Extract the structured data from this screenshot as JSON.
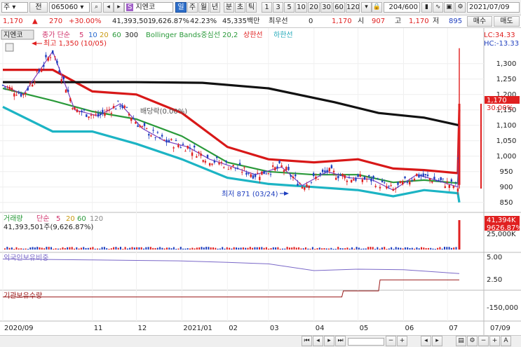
{
  "toolbar": {
    "market": "주",
    "type_label": "전",
    "code": "065060",
    "name": "지엔코",
    "name_tag": "일",
    "periods": [
      "주",
      "월",
      "년",
      "분",
      "초",
      "틱"
    ],
    "intervals": [
      "1",
      "3",
      "5",
      "10",
      "20",
      "30",
      "60",
      "120"
    ],
    "count": "204/600",
    "date": "2021/07/09"
  },
  "quote": {
    "price": "1,170",
    "change": "270",
    "change_pct": "+30.00%",
    "volume": "41,393,501",
    "vol_ratio": "9,626.87%",
    "turnover": "42.23%",
    "amount": "45,335백만",
    "prev_label": "최우선",
    "prev_value": "0",
    "open_price": "1,170",
    "open_label": "시",
    "open_value": "907",
    "high_label": "고",
    "high_value": "1,170",
    "low_label": "저",
    "low_value": "895",
    "sell_btn": "매수",
    "buy_btn": "매도"
  },
  "legend": {
    "name": "지엔코",
    "ma": "종가 단순",
    "p5": "5",
    "p10": "10",
    "p20": "20",
    "p60": "60",
    "p300": "300",
    "bb": "Bollinger Bands중심선 20,2",
    "upper": "상한선",
    "lower": "하한선",
    "lc": "LC:34.33",
    "hc": "HC:-13.33",
    "high_note": "최고 1,350 (10/05)",
    "low_note": "최저 871 (03/24)",
    "div_note": "배당락(0.00%)",
    "price_tag": "1,170",
    "pct_tag": "30.00%"
  },
  "volume_panel": {
    "legend": "거래량",
    "ma": "단순",
    "p5": "5",
    "p20": "20",
    "p60": "60",
    "p120": "120",
    "value": "41,393,501주(9,626.87%)",
    "tag1": "41,394K",
    "tag2": "9626.87%",
    "tick": "25,000K"
  },
  "foreign_panel": {
    "legend": "외국인보유비중",
    "ticks": [
      "5.00",
      "2.50"
    ]
  },
  "inst_panel": {
    "legend": "기관보유수량",
    "ticks": [
      "-150,000"
    ]
  },
  "chart_data": {
    "type": "candlestick",
    "title": "지엔코",
    "ylim": [
      820,
      1370
    ],
    "yticks": [
      1300,
      1250,
      1200,
      1150,
      1100,
      1050,
      1000,
      950,
      900,
      850
    ],
    "xticks": [
      "2020/09",
      "11",
      "12",
      "2021/01",
      "02",
      "03",
      "04",
      "05",
      "06",
      "07",
      "07/09"
    ],
    "close_path": [
      [
        "2020/09/01",
        1230
      ],
      [
        "2020/09/15",
        1200
      ],
      [
        "2020/10/05",
        1340
      ],
      [
        "2020/10/20",
        1150
      ],
      [
        "2020/11/05",
        1130
      ],
      [
        "2020/11/20",
        1170
      ],
      [
        "2020/12/05",
        1090
      ],
      [
        "2020/12/20",
        1050
      ],
      [
        "2021/01/05",
        1030
      ],
      [
        "2021/01/20",
        990
      ],
      [
        "2021/02/05",
        965
      ],
      [
        "2021/02/20",
        940
      ],
      [
        "2021/03/10",
        965
      ],
      [
        "2021/03/24",
        905
      ],
      [
        "2021/04/10",
        950
      ],
      [
        "2021/04/25",
        930
      ],
      [
        "2021/05/10",
        925
      ],
      [
        "2021/05/25",
        890
      ],
      [
        "2021/06/10",
        940
      ],
      [
        "2021/06/25",
        920
      ],
      [
        "2021/07/08",
        900
      ],
      [
        "2021/07/09",
        1170
      ]
    ],
    "ma300": [
      [
        "2020/09/01",
        1240
      ],
      [
        "2020/10/15",
        1240
      ],
      [
        "2020/12/01",
        1240
      ],
      [
        "2021/01/15",
        1238
      ],
      [
        "2021/03/01",
        1220
      ],
      [
        "2021/04/15",
        1175
      ],
      [
        "2021/05/15",
        1140
      ],
      [
        "2021/06/15",
        1125
      ],
      [
        "2021/07/09",
        1100
      ]
    ],
    "bb_upper": [
      [
        "2020/09/01",
        1280
      ],
      [
        "2020/10/05",
        1280
      ],
      [
        "2020/11/01",
        1210
      ],
      [
        "2020/12/01",
        1200
      ],
      [
        "2021/01/01",
        1140
      ],
      [
        "2021/02/01",
        1030
      ],
      [
        "2021/03/01",
        990
      ],
      [
        "2021/04/01",
        980
      ],
      [
        "2021/05/01",
        990
      ],
      [
        "2021/05/25",
        960
      ],
      [
        "2021/06/15",
        955
      ],
      [
        "2021/07/08",
        945
      ],
      [
        "2021/07/09",
        1150
      ]
    ],
    "bb_lower": [
      [
        "2020/09/01",
        1160
      ],
      [
        "2020/10/05",
        1080
      ],
      [
        "2020/11/01",
        1080
      ],
      [
        "2020/12/01",
        1040
      ],
      [
        "2021/01/01",
        990
      ],
      [
        "2021/02/01",
        930
      ],
      [
        "2021/03/01",
        910
      ],
      [
        "2021/04/01",
        900
      ],
      [
        "2021/05/01",
        890
      ],
      [
        "2021/05/25",
        870
      ],
      [
        "2021/06/15",
        890
      ],
      [
        "2021/07/08",
        880
      ],
      [
        "2021/07/09",
        850
      ]
    ],
    "high": {
      "value": 1350,
      "date": "2020/10/05"
    },
    "low": {
      "value": 871,
      "date": "2021/03/24"
    },
    "last": 1170,
    "foreign_ratio": [
      [
        "2020/09/01",
        5.0
      ],
      [
        "2020/10/01",
        4.9
      ],
      [
        "2020/11/01",
        4.8
      ],
      [
        "2020/12/01",
        4.7
      ],
      [
        "2021/01/01",
        4.6
      ],
      [
        "2021/02/01",
        4.3
      ],
      [
        "2021/03/01",
        4.0
      ],
      [
        "2021/04/01",
        2.6
      ],
      [
        "2021/05/01",
        2.9
      ],
      [
        "2021/06/01",
        2.8
      ],
      [
        "2021/07/09",
        2.0
      ]
    ],
    "inst_holdings": [
      [
        "2020/09/01",
        -20000
      ],
      [
        "2021/04/20",
        -20000
      ],
      [
        "2021/04/21",
        -90000
      ],
      [
        "2021/05/15",
        -90000
      ],
      [
        "2021/05/16",
        -220000
      ],
      [
        "2021/07/09",
        -220000
      ]
    ],
    "last_volume": 41393501
  }
}
